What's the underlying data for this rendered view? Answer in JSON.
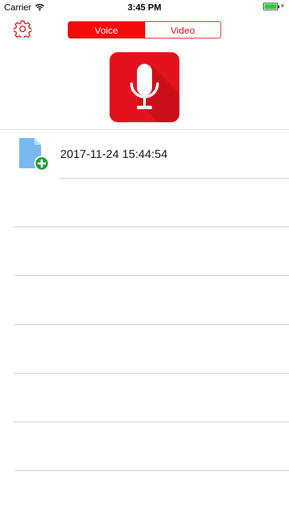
{
  "status_bar": {
    "carrier": "Carrier",
    "time": "3:45 PM"
  },
  "nav": {
    "settings_icon": "gear-icon",
    "tabs": [
      {
        "label": "Voice",
        "selected": true
      },
      {
        "label": "Video",
        "selected": false
      }
    ]
  },
  "record_button": {
    "icon": "microphone-icon"
  },
  "recordings": [
    {
      "title": "2017-11-24 15:44:54",
      "icon": "audio-file-add-icon"
    }
  ],
  "colors": {
    "accent": "#f50b0b",
    "record_bg": "#e4121f",
    "file_blue": "#7ab8f0",
    "add_green": "#1e9e3c",
    "battery_green": "#2ecc2e"
  }
}
